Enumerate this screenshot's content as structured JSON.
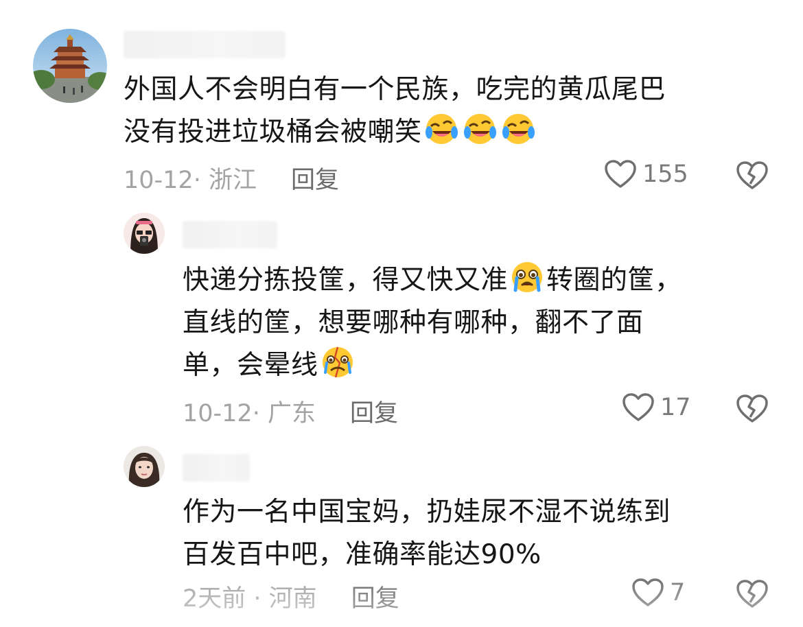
{
  "comments": [
    {
      "lines": [
        "外国人不会明白有一个民族，吃完的黄瓜尾巴",
        "没有投进垃圾桶会被嘲笑"
      ],
      "emojis": [
        "laughing-crying-emoji",
        "laughing-crying-emoji",
        "laughing-crying-emoji"
      ],
      "date": "10-12",
      "location": "浙江",
      "reply_label": "回复",
      "likes": "155"
    },
    {
      "lines": [
        "快递分拣投筐，得又快又准",
        "转圈的筐，",
        "直线的筐，想要哪种有哪种，翻不了面",
        "单，会晕线"
      ],
      "emojis": [
        "crying-emoji",
        "broken-face-emoji"
      ],
      "date": "10-12",
      "location": "广东",
      "reply_label": "回复",
      "likes": "17"
    },
    {
      "lines": [
        "作为一名中国宝妈，扔娃尿不湿不说练到",
        "百发百中吧，准确率能达90%"
      ],
      "date": "2天前",
      "location": "河南",
      "reply_label": "回复",
      "likes": "7"
    }
  ],
  "icons": {
    "like": "heart-outline-icon",
    "dislike": "broken-heart-icon"
  },
  "colors": {
    "text": "#161616",
    "meta": "#a3a3a3",
    "reply": "#6b6b6b",
    "icon": "#6f6f6f"
  }
}
